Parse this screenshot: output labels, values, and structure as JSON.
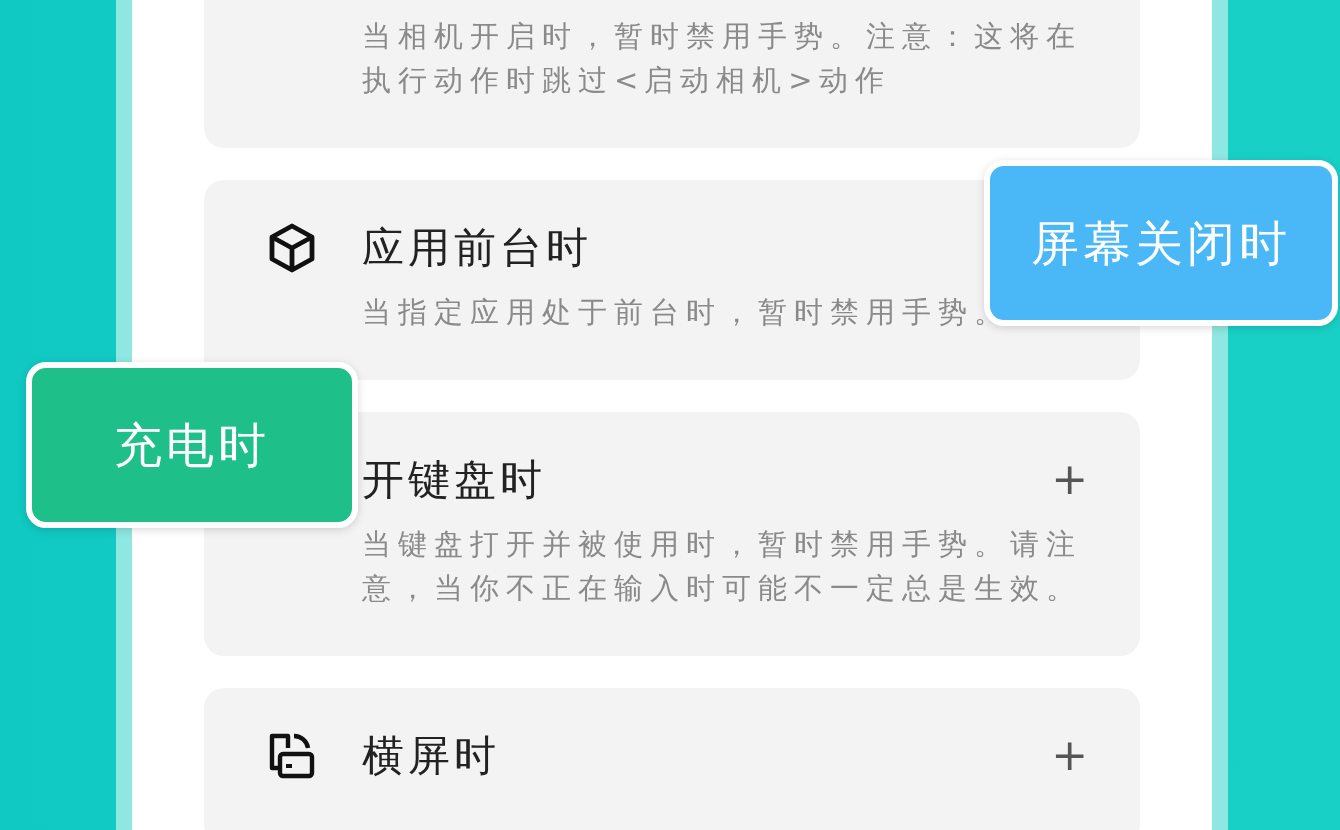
{
  "cards": [
    {
      "description": "当相机开启时，暂时禁用手势。注意：这将在执行动作时跳过<启动相机>动作"
    },
    {
      "title": "应用前台时",
      "description": "当指定应用处于前台时，暂时禁用手势。"
    },
    {
      "title": "开键盘时",
      "description": "当键盘打开并被使用时，暂时禁用手势。请注意，当你不正在输入时可能不一定总是生效。",
      "expand_symbol": "+"
    },
    {
      "title": "横屏时",
      "expand_symbol": "+"
    }
  ],
  "badges": [
    {
      "label": "屏幕关闭时",
      "kind": "blue"
    },
    {
      "label": "充电时",
      "kind": "green"
    }
  ]
}
